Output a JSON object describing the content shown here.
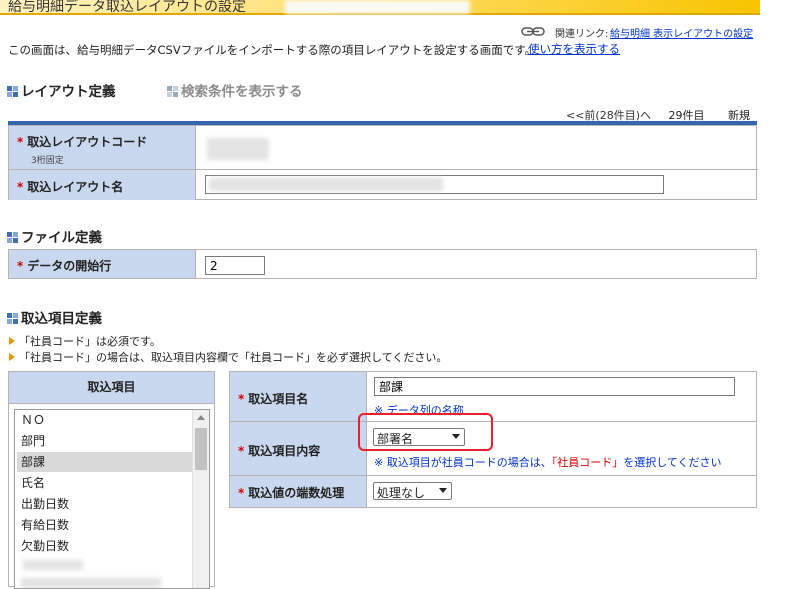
{
  "header": {
    "title": "給与明細データ取込レイアウトの設定",
    "related_label": "関連リンク:",
    "related_link": "給与明細 表示レイアウトの設定",
    "description": "この画面は、給与明細データCSVファイルをインポートする際の項目レイアウトを設定する画面です。",
    "howto_link": "使い方を表示する"
  },
  "sections": {
    "layout_def": "レイアウト定義",
    "search_toggle": "検索条件を表示する",
    "file_def": "ファイル定義",
    "item_def": "取込項目定義"
  },
  "pager": {
    "prev": "<<前(28件目)へ",
    "current": "29件目",
    "new": "新規"
  },
  "layout_form": {
    "code_label": "取込レイアウトコード",
    "code_sub": "3桁固定",
    "name_label": "取込レイアウト名",
    "required_mark": "*"
  },
  "file_form": {
    "start_row_label": "データの開始行",
    "start_row_value": "2"
  },
  "notes": [
    "「社員コード」は必須です。",
    "「社員コード」の場合は、取込項目内容欄で「社員コード」を必ず選択してください。"
  ],
  "item_list": {
    "header": "取込項目",
    "items": [
      "ＮＯ",
      "部門",
      "部課",
      "氏名",
      "出勤日数",
      "有給日数",
      "欠勤日数"
    ],
    "selected": "部課"
  },
  "item_detail": {
    "name_label": "取込項目名",
    "name_value": "部課",
    "name_note": "※ データ列の名称",
    "content_label": "取込項目内容",
    "content_value": "部署名",
    "content_note_prefix": "※ 取込項目が社員コードの場合は、",
    "content_note_highlight": "「社員コード」",
    "content_note_suffix": "を選択してください",
    "fraction_label": "取込値の端数処理",
    "fraction_value": "処理なし"
  },
  "colors": {
    "label_bg": "#c9d8ee",
    "blue_bar": "#3566ad",
    "required": "#d40000",
    "note_blue": "#0033cc",
    "highlight_box": "#e8202a"
  }
}
